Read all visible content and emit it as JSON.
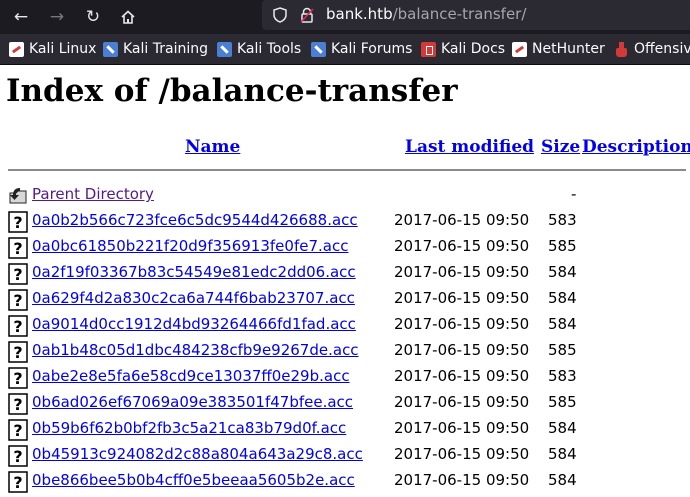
{
  "browser": {
    "url_host": "bank.htb",
    "url_path": "/balance-transfer/",
    "bookmarks": [
      {
        "label": "Kali Linux",
        "icon": "kali-icon"
      },
      {
        "label": "Kali Training",
        "icon": "kali-training-icon"
      },
      {
        "label": "Kali Tools",
        "icon": "kali-tools-icon"
      },
      {
        "label": "Kali Forums",
        "icon": "kali-forums-icon"
      },
      {
        "label": "Kali Docs",
        "icon": "kali-docs-icon"
      },
      {
        "label": "NetHunter",
        "icon": "nethunter-icon"
      },
      {
        "label": "Offensive",
        "icon": "offensive-security-icon"
      }
    ]
  },
  "page": {
    "title": "Index of /balance-transfer",
    "columns": {
      "name": "Name",
      "last_modified": "Last modified",
      "size": "Size",
      "description": "Description"
    },
    "parent": {
      "name": "Parent Directory",
      "size": "-"
    },
    "files": [
      {
        "name": "0a0b2b566c723fce6c5dc9544d426688.acc",
        "modified": "2017-06-15 09:50",
        "size": "583"
      },
      {
        "name": "0a0bc61850b221f20d9f356913fe0fe7.acc",
        "modified": "2017-06-15 09:50",
        "size": "585"
      },
      {
        "name": "0a2f19f03367b83c54549e81edc2dd06.acc",
        "modified": "2017-06-15 09:50",
        "size": "584"
      },
      {
        "name": "0a629f4d2a830c2ca6a744f6bab23707.acc",
        "modified": "2017-06-15 09:50",
        "size": "584"
      },
      {
        "name": "0a9014d0cc1912d4bd93264466fd1fad.acc",
        "modified": "2017-06-15 09:50",
        "size": "584"
      },
      {
        "name": "0ab1b48c05d1dbc484238cfb9e9267de.acc",
        "modified": "2017-06-15 09:50",
        "size": "585"
      },
      {
        "name": "0abe2e8e5fa6e58cd9ce13037ff0e29b.acc",
        "modified": "2017-06-15 09:50",
        "size": "583"
      },
      {
        "name": "0b6ad026ef67069a09e383501f47bfee.acc",
        "modified": "2017-06-15 09:50",
        "size": "585"
      },
      {
        "name": "0b59b6f62b0bf2fb3c5a21ca83b79d0f.acc",
        "modified": "2017-06-15 09:50",
        "size": "584"
      },
      {
        "name": "0b45913c924082d2c88a804a643a29c8.acc",
        "modified": "2017-06-15 09:50",
        "size": "584"
      },
      {
        "name": "0be866bee5b0b4cff0e5beeaa5605b2e.acc",
        "modified": "2017-06-15 09:50",
        "size": "584"
      }
    ]
  }
}
